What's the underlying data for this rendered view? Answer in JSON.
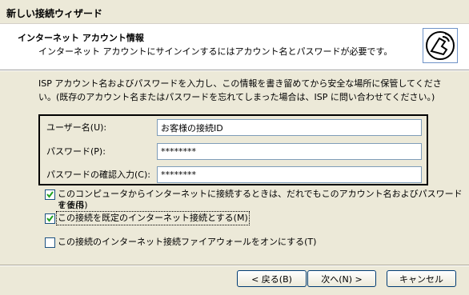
{
  "window": {
    "title": "新しい接続ウィザード"
  },
  "header": {
    "title": "インターネット アカウント情報",
    "subtitle": "インターネット アカウントにサインインするにはアカウント名とパスワードが必要です。",
    "icon": "phone-connection-icon"
  },
  "intro_text": "ISP アカウント名およびパスワードを入力し、この情報を書き留めてから安全な場所に保管してください。(既存のアカウント名またはパスワードを忘れてしまった場合は、ISP に問い合わせてください。)",
  "fields": {
    "username": {
      "label": "ユーザー名(U):",
      "value": "お客様の接続ID"
    },
    "password": {
      "label": "パスワード(P):",
      "value": "********"
    },
    "confirm": {
      "label": "パスワードの確認入力(C):",
      "value": "********"
    }
  },
  "checkboxes": {
    "shared": {
      "label_line1": "このコンピュータからインターネットに接続するときは、だれでもこのアカウント名およびパスワードを使用",
      "label_line2": "する(S)",
      "checked": true
    },
    "default": {
      "label": "この接続を既定のインターネット接続とする(M)",
      "checked": true
    },
    "firewall": {
      "label": "この接続のインターネット接続ファイアウォールをオンにする(T)",
      "checked": false
    }
  },
  "buttons": {
    "back": "< 戻る(B)",
    "next": "次へ(N) >",
    "cancel": "キャンセル"
  }
}
